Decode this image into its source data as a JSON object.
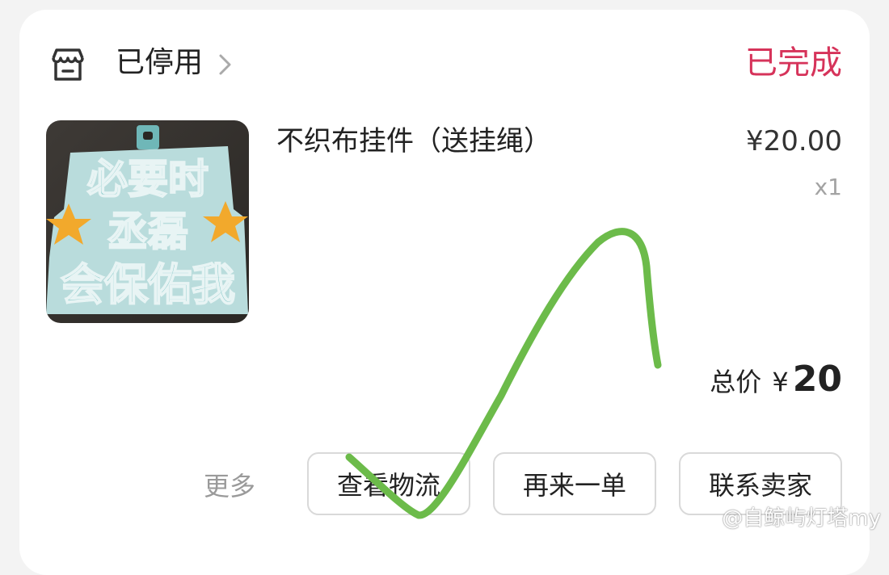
{
  "order": {
    "shop_name": "已停用",
    "status": "已完成",
    "status_color": "#d6335a",
    "product": {
      "title": "不织布挂件（送挂绳）",
      "price": "¥20.00",
      "quantity": "x1",
      "image_text": [
        "必要时",
        "丞磊",
        "会保佑我"
      ]
    },
    "total_label": "总价",
    "total_currency": "¥",
    "total_amount": "20"
  },
  "actions": {
    "more": "更多",
    "view_logistics": "查看物流",
    "reorder": "再来一单",
    "contact_seller": "联系卖家"
  },
  "icons": {
    "shop": "shop-icon",
    "chevron": "chevron-right-icon"
  },
  "watermark": "@自鲸屿灯塔my"
}
